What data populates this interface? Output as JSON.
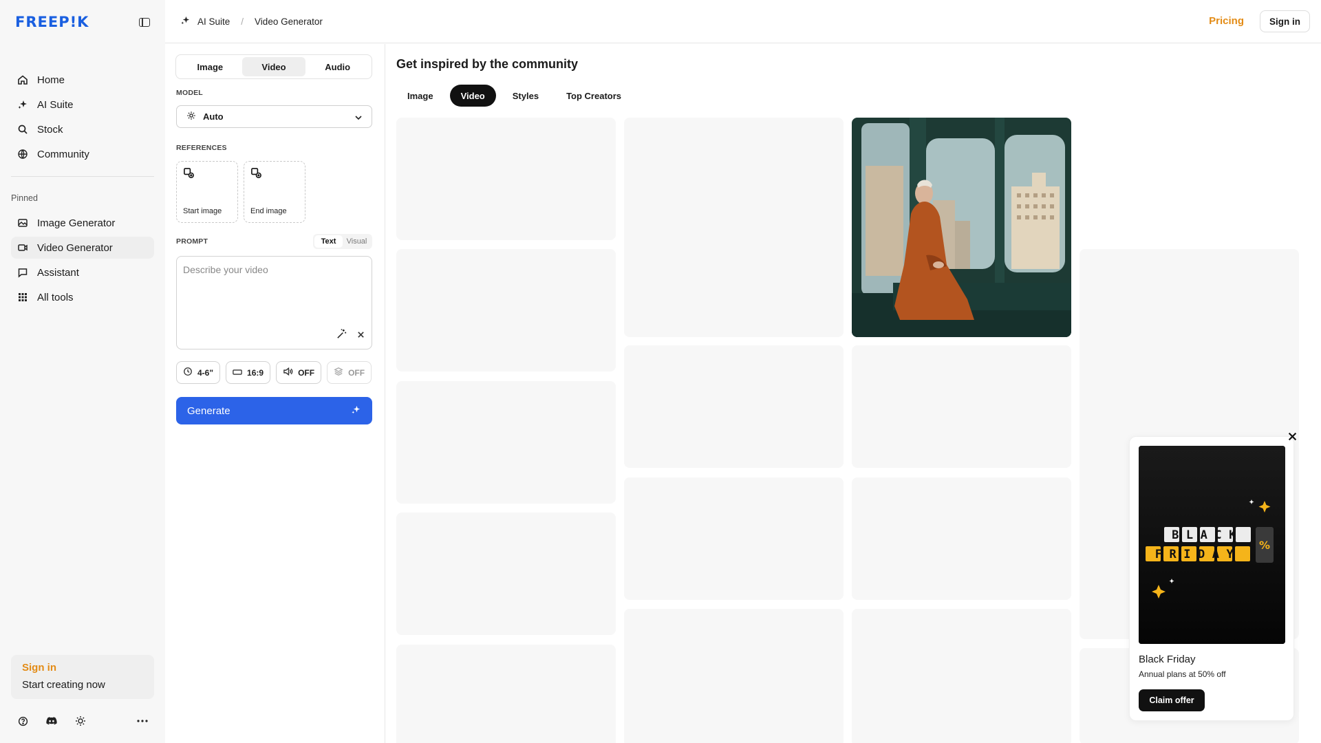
{
  "sidebar": {
    "logo": "FREEP!K",
    "nav": [
      {
        "label": "Home",
        "icon": "home-icon"
      },
      {
        "label": "AI Suite",
        "icon": "sparkle-icon"
      },
      {
        "label": "Stock",
        "icon": "search-icon"
      },
      {
        "label": "Community",
        "icon": "globe-icon"
      }
    ],
    "pinned_label": "Pinned",
    "pinned": [
      {
        "label": "Image Generator",
        "icon": "image-icon"
      },
      {
        "label": "Video Generator",
        "icon": "video-icon",
        "active": true
      },
      {
        "label": "Assistant",
        "icon": "chat-icon"
      },
      {
        "label": "All tools",
        "icon": "grid-icon"
      }
    ],
    "signin_card": {
      "title": "Sign in",
      "subtitle": "Start creating now"
    }
  },
  "topbar": {
    "breadcrumb": [
      "AI Suite",
      "Video Generator"
    ],
    "pricing": "Pricing",
    "signin": "Sign in"
  },
  "panel": {
    "tabs": [
      "Image",
      "Video",
      "Audio"
    ],
    "selected_tab": "Video",
    "model_label": "MODEL",
    "model_value": "Auto",
    "references_label": "REFERENCES",
    "references": [
      "Start image",
      "End image"
    ],
    "prompt_label": "PROMPT",
    "prompt_modes": [
      "Text",
      "Visual"
    ],
    "prompt_placeholder": "Describe your video",
    "chips": {
      "duration": "4-6\"",
      "ratio": "16:9",
      "audio": "OFF",
      "extra": "OFF"
    },
    "generate": "Generate"
  },
  "main": {
    "title": "Get inspired by the community",
    "tabs": [
      "Image",
      "Video",
      "Styles",
      "Top Creators"
    ],
    "selected_tab": "Video"
  },
  "promo": {
    "banner_text": {
      "line1": "BLACK",
      "line2": "FRIDAY",
      "symbol": "%"
    },
    "title": "Black Friday",
    "subtitle": "Annual plans at 50% off",
    "cta": "Claim offer"
  },
  "colors": {
    "brand": "#1A5FE0",
    "accent": "#E38B15",
    "primary_button": "#2C63E8"
  }
}
